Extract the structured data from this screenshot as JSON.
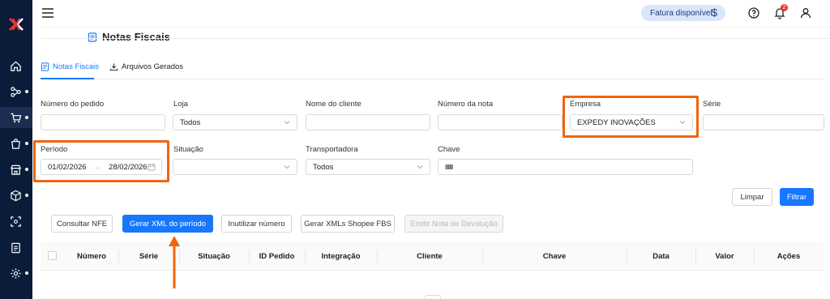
{
  "header": {
    "fatura_label": "Fatura disponível",
    "fatura_symbol": "$",
    "notification_count": "2"
  },
  "page": {
    "title": "Notas Fiscais"
  },
  "tabs": [
    {
      "label": "Notas Fiscais",
      "active": true,
      "icon": "document-icon"
    },
    {
      "label": "Arquivos Gerados",
      "active": false,
      "icon": "download-icon"
    }
  ],
  "filters": {
    "numero_pedido": {
      "label": "Número do pedido",
      "value": ""
    },
    "loja": {
      "label": "Loja",
      "value": "Todos"
    },
    "nome_cliente": {
      "label": "Nome do cliente",
      "value": ""
    },
    "numero_nota": {
      "label": "Número da nota",
      "value": ""
    },
    "empresa": {
      "label": "Empresa",
      "value": "EXPEDY INOVAÇÕES"
    },
    "serie": {
      "label": "Série",
      "value": ""
    },
    "periodo": {
      "label": "Período",
      "start": "01/02/2026",
      "separator": "→",
      "end": "28/02/2026"
    },
    "situacao": {
      "label": "Situação",
      "value": ""
    },
    "transportadora": {
      "label": "Transportadora",
      "value": "Todos"
    },
    "chave": {
      "label": "Chave",
      "value": ""
    }
  },
  "actions": {
    "limpar": "Limpar",
    "filtrar": "Filtrar",
    "consultar_nfe": "Consultar NFE",
    "gerar_xml": "Gerar XML do período",
    "inutilizar": "Inutilizar número",
    "gerar_xmls_shopee": "Gerar XMLs Shopee FBS",
    "emitir_devolucao": "Emitir Nota de Devolução"
  },
  "table": {
    "columns": [
      "Número",
      "Série",
      "Situação",
      "ID Pedido",
      "Integração",
      "Cliente",
      "Chave",
      "Data",
      "Valor",
      "Ações"
    ]
  },
  "colors": {
    "sidebar": "#0b1c3a",
    "accent": "#1677ff",
    "highlight": "#f0640f",
    "logo_red": "#e53935"
  }
}
